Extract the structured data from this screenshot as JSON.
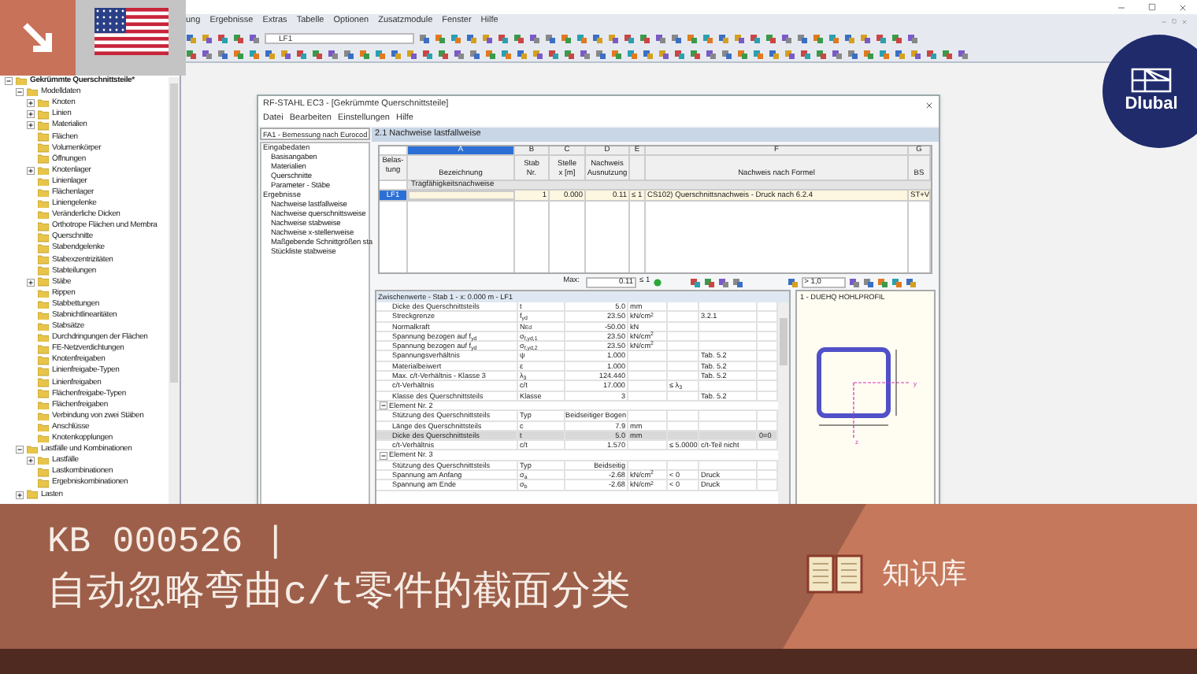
{
  "window": {
    "menu": [
      "ung",
      "Ergebnisse",
      "Extras",
      "Tabelle",
      "Optionen",
      "Zusatzmodule",
      "Fenster",
      "Hilfe"
    ],
    "toolbar_field": "LF1"
  },
  "navigator": {
    "tree": [
      {
        "label": "Gekrümmte Querschnittsteile*",
        "expanded": true,
        "children": [
          {
            "label": "Modelldaten",
            "expanded": true,
            "children": [
              {
                "label": "Knoten",
                "expanded": false
              },
              {
                "label": "Linien",
                "expanded": false
              },
              {
                "label": "Materialien",
                "expanded": false
              },
              {
                "label": "Flächen"
              },
              {
                "label": "Volumenkörper"
              },
              {
                "label": "Öffnungen"
              },
              {
                "label": "Knotenlager",
                "expanded": false
              },
              {
                "label": "Linienlager"
              },
              {
                "label": "Flächenlager"
              },
              {
                "label": "Liniengelenke"
              },
              {
                "label": "Veränderliche Dicken"
              },
              {
                "label": "Orthotrope Flächen und Membra"
              },
              {
                "label": "Querschnitte"
              },
              {
                "label": "Stabendgelenke"
              },
              {
                "label": "Stabexzentrizitäten"
              },
              {
                "label": "Stabteilungen"
              },
              {
                "label": "Stäbe",
                "expanded": false
              },
              {
                "label": "Rippen"
              },
              {
                "label": "Stabbettungen"
              },
              {
                "label": "Stabnichtlinearitäten"
              },
              {
                "label": "Stabsätze"
              },
              {
                "label": "Durchdringungen der Flächen"
              },
              {
                "label": "FE-Netzverdichtungen"
              },
              {
                "label": "Knotenfreigaben"
              },
              {
                "label": "Linienfreigabe-Typen"
              },
              {
                "label": "Linienfreigaben"
              },
              {
                "label": "Flächenfreigabe-Typen"
              },
              {
                "label": "Flächenfreigaben"
              },
              {
                "label": "Verbindung von zwei Stäben"
              },
              {
                "label": "Anschlüsse"
              },
              {
                "label": "Knotenkopplungen"
              }
            ]
          },
          {
            "label": "Lastfälle und Kombinationen",
            "expanded": true,
            "children": [
              {
                "label": "Lastfälle",
                "expanded": false
              },
              {
                "label": "Lastkombinationen"
              },
              {
                "label": "Ergebniskombinationen"
              }
            ]
          },
          {
            "label": "Lasten",
            "expanded": false
          }
        ]
      }
    ]
  },
  "dialog": {
    "title": "RF-STAHL EC3 - [Gekrümmte Querschnittsteile]",
    "menu": [
      "Datei",
      "Bearbeiten",
      "Einstellungen",
      "Hilfe"
    ],
    "case": "FA1 - Bemessung nach Eurocod",
    "nav": [
      {
        "label": "Eingabedaten",
        "children": [
          {
            "label": "Basisangaben"
          },
          {
            "label": "Materialien"
          },
          {
            "label": "Querschnitte"
          },
          {
            "label": "Parameter - Stäbe"
          }
        ]
      },
      {
        "label": "Ergebnisse",
        "children": [
          {
            "label": "Nachweise lastfallweise"
          },
          {
            "label": "Nachweise querschnittsweise"
          },
          {
            "label": "Nachweise stabweise"
          },
          {
            "label": "Nachweise x-stellenweise"
          },
          {
            "label": "Maßgebende Schnittgrößen sta"
          },
          {
            "label": "Stückliste stabweise"
          }
        ]
      }
    ],
    "panel_title": "2.1 Nachweise lastfallweise",
    "table": {
      "row_header": "Belas-\ntung",
      "columns": [
        {
          "letter": "A",
          "title": "Bezeichnung",
          "selected": true
        },
        {
          "letter": "B",
          "title": "Stab\nNr.",
          "selected": false
        },
        {
          "letter": "C",
          "title": "Stelle\nx [m]",
          "selected": false
        },
        {
          "letter": "D",
          "title": "Nachweis\nAusnutzung",
          "selected": false
        },
        {
          "letter": "E",
          "selected": false
        },
        {
          "letter": "F",
          "title": "Nachweis nach Formel",
          "selected": false
        },
        {
          "letter": "G",
          "title": "BS",
          "selected": false
        }
      ],
      "group": "Tragfähigkeitsnachweise",
      "rows": [
        {
          "case": "LF1",
          "selected": true,
          "cells": [
            "",
            "1",
            "0.000",
            "0.11",
            "≤ 1",
            "CS102) Querschnittsnachweis - Druck nach 6.2.4",
            "ST+V"
          ]
        }
      ]
    },
    "max": {
      "label": "Max:",
      "value": "0.11",
      "limit": "≤ 1",
      "filter": "> 1,0"
    },
    "details": {
      "title": "Zwischenwerte - Stab 1 - x: 0.000 m - LF1",
      "rows": [
        {
          "kind": "row",
          "selected": false,
          "label": "Dicke des Querschnittsteils",
          "symbol": "t",
          "value": "5.0",
          "unit": "mm"
        },
        {
          "kind": "row",
          "selected": false,
          "label": "Streckgrenze",
          "symbol": "f$_{yd}$",
          "value": "23.50",
          "unit": "kN/cm$^{2}$",
          "reference": "3.2.1"
        },
        {
          "kind": "row",
          "selected": false,
          "label": "Normalkraft",
          "symbol": "N$_{Ed}$",
          "value": "-50.00",
          "unit": "kN"
        },
        {
          "kind": "row",
          "selected": false,
          "label": "Spannung bezogen auf f$_{yd}$",
          "symbol": "σ$_{f,yd,1}$",
          "value": "23.50",
          "unit": "kN/cm$^{2}$"
        },
        {
          "kind": "row",
          "selected": false,
          "label": "Spannung bezogen auf f$_{yd}$",
          "symbol": "σ$_{f,yd,2}$",
          "value": "23.50",
          "unit": "kN/cm$^{2}$"
        },
        {
          "kind": "row",
          "selected": false,
          "label": "Spannungsverhältnis",
          "symbol": "ψ",
          "value": "1.000",
          "reference": "Tab. 5.2"
        },
        {
          "kind": "row",
          "selected": false,
          "label": "Materialbeiwert",
          "symbol": "ε",
          "value": "1.000",
          "reference": "Tab. 5.2"
        },
        {
          "kind": "row",
          "selected": false,
          "label": "Max. c/t-Verhältnis - Klasse 3",
          "symbol": "λ$_{3}$",
          "value": "124.440",
          "reference": "Tab. 5.2"
        },
        {
          "kind": "row",
          "selected": false,
          "label": "c/t-Verhältnis",
          "symbol": "c/t",
          "value": "17.000",
          "condition": "≤ λ$_{3}$"
        },
        {
          "kind": "row",
          "selected": false,
          "label": "Klasse des Querschnittsteils",
          "symbol": "Klasse",
          "value": "3",
          "reference": "Tab. 5.2"
        },
        {
          "kind": "group",
          "selected": false,
          "label": "Element Nr. 2"
        },
        {
          "kind": "row",
          "selected": false,
          "label": "Stützung des Querschnittsteils",
          "symbol": "Typ",
          "value": "Beidseitiger Bogen"
        },
        {
          "kind": "row",
          "selected": false,
          "label": "Länge des Querschnittsteils",
          "symbol": "c",
          "value": "7.9",
          "unit": "mm"
        },
        {
          "kind": "row",
          "selected": true,
          "label": "Dicke des Querschnittsteils",
          "symbol": "t",
          "value": "5.0",
          "unit": "mm",
          "column_7": "0=0"
        },
        {
          "kind": "row",
          "selected": false,
          "label": "c/t-Verhältnis",
          "symbol": "c/t",
          "value": "1.570",
          "condition": "≤ 5.0000",
          "reference": "c/t-Teil nicht"
        },
        {
          "kind": "group",
          "selected": false,
          "label": "Element Nr. 3"
        },
        {
          "kind": "row",
          "selected": false,
          "label": "Stützung des Querschnittsteils",
          "symbol": "Typ",
          "value": "Beidseitig"
        },
        {
          "kind": "row",
          "selected": false,
          "label": "Spannung am Anfang",
          "symbol": "σ$_{a}$",
          "value": "-2.68",
          "unit": "kN/cm$^{2}$",
          "condition": "< 0",
          "reference": "Druck"
        },
        {
          "kind": "row",
          "selected": false,
          "label": "Spannung am Ende",
          "symbol": "σ$_{b}$",
          "value": "-2.68",
          "unit": "kN/cm$^{2}$",
          "condition": "< 0",
          "reference": "Druck"
        }
      ]
    },
    "section": {
      "title": "1 - DUEHQ HOHLPROFIL",
      "axis_labels": [
        "y",
        "z"
      ]
    }
  },
  "logo": {
    "text": "Dlubal"
  },
  "banner": {
    "code": "KB 000526 |",
    "title": "自动忽略弯曲c/t零件的截面分类",
    "category": "知识库"
  }
}
